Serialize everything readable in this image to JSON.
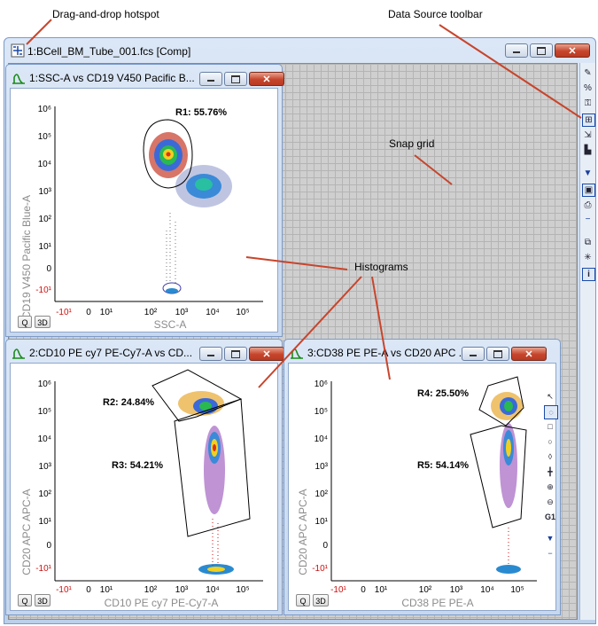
{
  "annotations": {
    "hotspot": "Drag-and-drop hotspot",
    "toolbar": "Data Source toolbar",
    "snap_grid": "Snap grid",
    "histograms": "Histograms"
  },
  "main_window": {
    "title": "1:BCell_BM_Tube_001.fcs [Comp]"
  },
  "plots": [
    {
      "title": "1:SSC-A vs CD19 V450 Pacific B...",
      "x_label": "SSC-A",
      "y_label": "CD19 V450 Pacific Blue-A",
      "x_ticks": [
        "-10¹",
        "0",
        "10¹",
        "10²",
        "10³",
        "10⁴",
        "10⁵"
      ],
      "y_ticks": [
        "10⁶",
        "10⁵",
        "10⁴",
        "10³",
        "10²",
        "10¹",
        "0",
        "-10¹"
      ],
      "regions": [
        {
          "label": "R1: 55.76%"
        }
      ],
      "q_label": "Q",
      "threed_label": "3D"
    },
    {
      "title": "2:CD10 PE cy7 PE-Cy7-A vs CD...",
      "x_label": "CD10 PE cy7 PE-Cy7-A",
      "y_label": "CD20 APC APC-A",
      "x_ticks": [
        "-10¹",
        "0",
        "10¹",
        "10²",
        "10³",
        "10⁴",
        "10⁵"
      ],
      "y_ticks": [
        "10⁶",
        "10⁵",
        "10⁴",
        "10³",
        "10²",
        "10¹",
        "0",
        "-10¹"
      ],
      "regions": [
        {
          "label": "R2: 24.84%"
        },
        {
          "label": "R3: 54.21%"
        }
      ],
      "q_label": "Q",
      "threed_label": "3D"
    },
    {
      "title": "3:CD38 PE PE-A vs CD20 APC ...",
      "x_label": "CD38 PE PE-A",
      "y_label": "CD20 APC APC-A",
      "x_ticks": [
        "-10¹",
        "0",
        "10¹",
        "10²",
        "10³",
        "10⁴",
        "10⁵"
      ],
      "y_ticks": [
        "10⁶",
        "10⁵",
        "10⁴",
        "10³",
        "10²",
        "10¹",
        "0",
        "-10¹"
      ],
      "regions": [
        {
          "label": "R4: 25.50%"
        },
        {
          "label": "R5: 54.14%"
        }
      ],
      "q_label": "Q",
      "threed_label": "3D"
    }
  ],
  "toolbar_icons": [
    "pencil-icon",
    "percent-icon",
    "key-icon",
    "grid-icon",
    "export-icon",
    "chart-icon",
    "arrow-down-icon",
    "layout-icon",
    "print-icon",
    "minus-icon",
    "copy-icon",
    "sparkle-icon",
    "info-icon"
  ],
  "gate_tools": [
    "pointer-icon",
    "lasso-icon",
    "rectangle-icon",
    "ellipse-icon",
    "polygon-icon",
    "quadrant-icon",
    "zoom-in-icon",
    "zoom-out-icon",
    "gate1-icon",
    "dropdown-icon",
    "minus-icon"
  ],
  "gate_tool_g1": "G1",
  "colors": {
    "accent": "#c8452c",
    "window_border": "#7c9ac8",
    "grid": "#cfcfcf"
  }
}
